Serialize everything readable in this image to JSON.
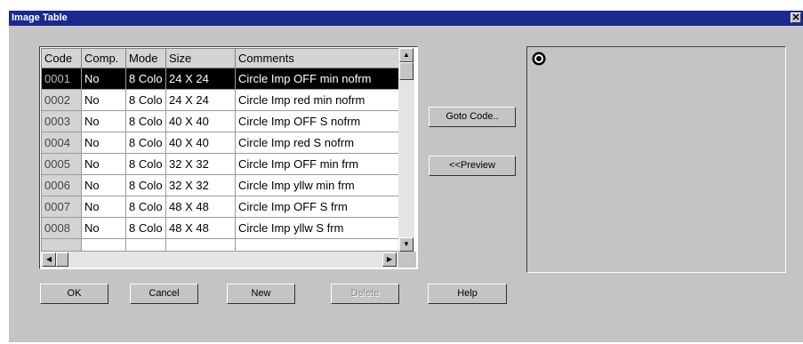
{
  "window": {
    "title": "Image Table",
    "close_glyph": "✕"
  },
  "table": {
    "columns": [
      "Code",
      "Comp.",
      "Mode",
      "Size",
      "Comments"
    ],
    "rows": [
      {
        "code": "0001",
        "comp": "No",
        "mode": "8 Colo",
        "size": "24 X 24",
        "comments": "Circle Imp OFF min nofrm"
      },
      {
        "code": "0002",
        "comp": "No",
        "mode": "8 Colo",
        "size": "24 X 24",
        "comments": "Circle Imp red min nofrm"
      },
      {
        "code": "0003",
        "comp": "No",
        "mode": "8 Colo",
        "size": "40 X 40",
        "comments": "Circle Imp OFF S nofrm"
      },
      {
        "code": "0004",
        "comp": "No",
        "mode": "8 Colo",
        "size": "40 X 40",
        "comments": "Circle Imp red S nofrm"
      },
      {
        "code": "0005",
        "comp": "No",
        "mode": "8 Colo",
        "size": "32 X 32",
        "comments": "Circle Imp OFF min frm"
      },
      {
        "code": "0006",
        "comp": "No",
        "mode": "8 Colo",
        "size": "32 X 32",
        "comments": "Circle Imp yllw min frm"
      },
      {
        "code": "0007",
        "comp": "No",
        "mode": "8 Colo",
        "size": "48 X 48",
        "comments": "Circle Imp OFF S frm"
      },
      {
        "code": "0008",
        "comp": "No",
        "mode": "8 Colo",
        "size": "48 X 48",
        "comments": "Circle Imp yllw S frm"
      }
    ],
    "selected_row": "0001"
  },
  "side_buttons": {
    "goto_code": "Goto Code..",
    "preview": "<<Preview"
  },
  "bottom_buttons": {
    "ok": "OK",
    "cancel": "Cancel",
    "new": "New",
    "delete": "Delete",
    "help": "Help"
  },
  "colors": {
    "titlebar": "#1a2a8e",
    "dialog_bg": "#c4c4c4",
    "selection": "#000000"
  }
}
